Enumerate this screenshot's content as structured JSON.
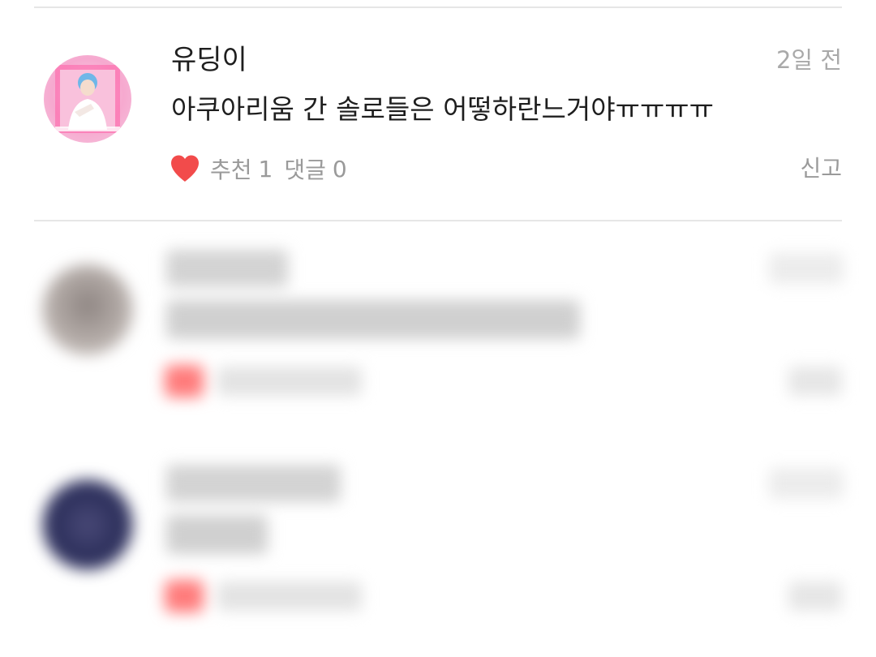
{
  "comment": {
    "username": "유딩이",
    "time": "2일 전",
    "text": "아쿠아리움 간 솔로들은 어떻하란느거야ㅠㅠㅠㅠ",
    "like_label": "추천",
    "like_count": "1",
    "comment_label": "댓글",
    "comment_count": "0",
    "report_label": "신고",
    "heart_icon": "heart-icon",
    "heart_color": "#f24b4b"
  },
  "colors": {
    "text_primary": "#1e1e1e",
    "text_secondary": "#9a9a9a",
    "divider": "#e6e6e6"
  }
}
